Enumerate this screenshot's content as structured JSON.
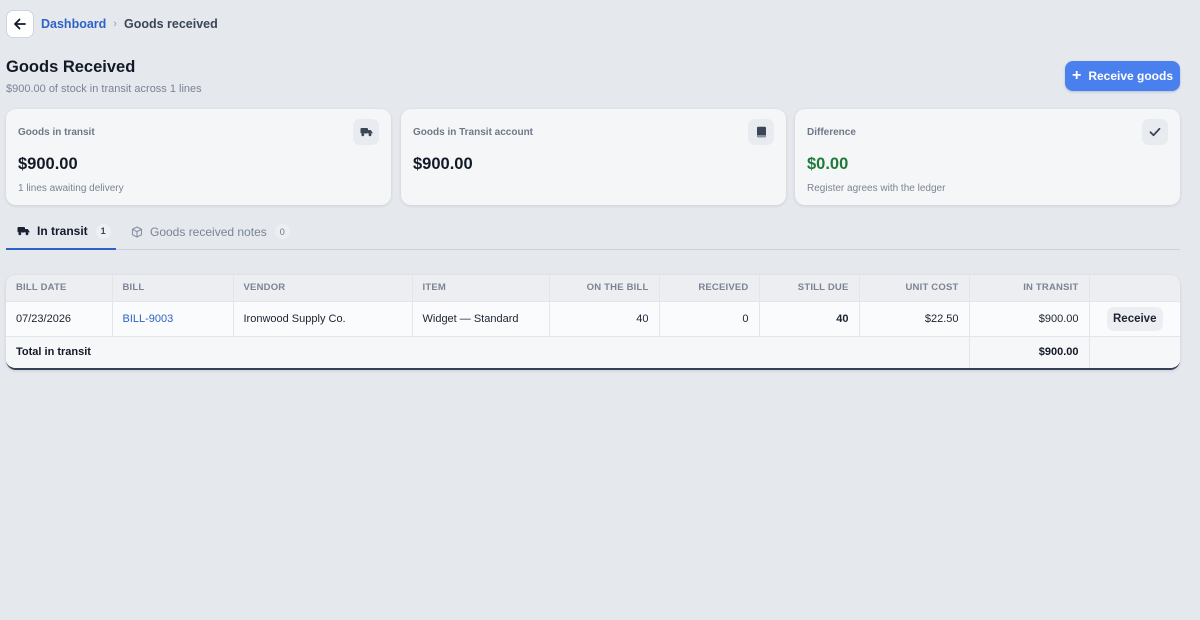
{
  "breadcrumb": {
    "parent": "Dashboard",
    "separator": "›",
    "current": "Goods received"
  },
  "page": {
    "title": "Goods Received",
    "subtitle": "$900.00 of stock in transit across 1 lines"
  },
  "actions": {
    "receive_goods": "Receive goods",
    "plus": "+"
  },
  "cards": [
    {
      "label": "Goods in transit",
      "value": "$900.00",
      "note": "1 lines awaiting delivery",
      "icon": "truck-icon"
    },
    {
      "label": "Goods in Transit account",
      "value": "$900.00",
      "note": "",
      "icon": "book-icon"
    },
    {
      "label": "Difference",
      "value": "$0.00",
      "note": "Register agrees with the ledger",
      "icon": "check-icon",
      "value_color": "#1e7a3a"
    }
  ],
  "tabs": [
    {
      "label": "In transit",
      "count": "1",
      "active": true,
      "icon": "truck-icon"
    },
    {
      "label": "Goods received notes",
      "count": "0",
      "active": false,
      "icon": "box-icon"
    }
  ],
  "table": {
    "headers": [
      "BILL DATE",
      "BILL",
      "VENDOR",
      "ITEM",
      "ON THE BILL",
      "RECEIVED",
      "STILL DUE",
      "UNIT COST",
      "IN TRANSIT",
      ""
    ],
    "rows": [
      {
        "bill_date": "07/23/2026",
        "bill": "BILL-9003",
        "vendor": "Ironwood Supply Co.",
        "item": "Widget — Standard",
        "on_bill": "40",
        "received": "0",
        "still_due": "40",
        "unit_cost": "$22.50",
        "in_transit": "$900.00",
        "action": "Receive"
      }
    ],
    "footer": {
      "label": "Total in transit",
      "total": "$900.00"
    }
  },
  "colors": {
    "accent": "#4a80ee",
    "link": "#2e63c6",
    "positive": "#1e7a3a",
    "background": "#e5e8ed"
  }
}
